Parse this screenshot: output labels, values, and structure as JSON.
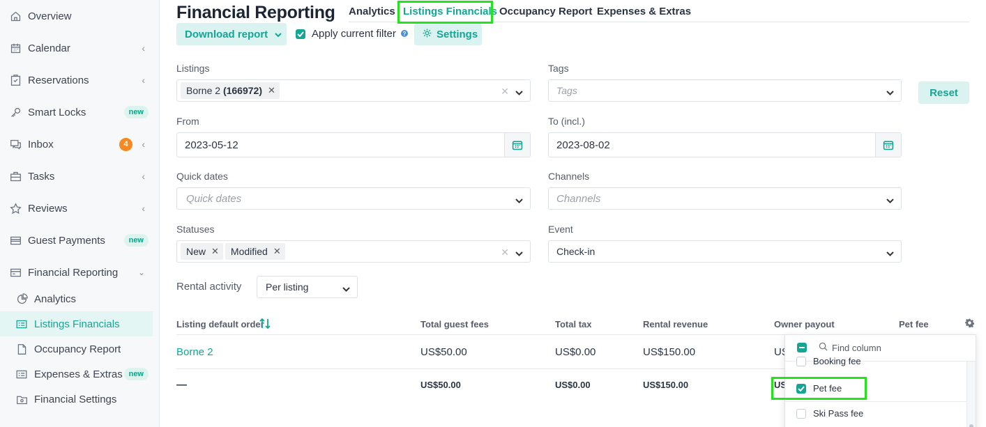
{
  "sidebar": {
    "items": [
      {
        "label": "Overview",
        "icon": "home-icon"
      },
      {
        "label": "Calendar",
        "icon": "calendar-icon"
      },
      {
        "label": "Reservations",
        "icon": "clipboard-check-icon"
      },
      {
        "label": "Smart Locks",
        "icon": "key-icon",
        "badge": "new"
      },
      {
        "label": "Inbox",
        "icon": "chat-icon",
        "count": "4"
      },
      {
        "label": "Tasks",
        "icon": "briefcase-icon"
      },
      {
        "label": "Reviews",
        "icon": "star-icon"
      },
      {
        "label": "Guest Payments",
        "icon": "credit-card-icon",
        "badge": "new"
      },
      {
        "label": "Financial Reporting",
        "icon": "credit-card-icon"
      }
    ],
    "sub_items": [
      {
        "label": "Analytics",
        "icon": "pie-chart-icon"
      },
      {
        "label": "Listings Financials",
        "icon": "list-card-icon"
      },
      {
        "label": "Occupancy Report",
        "icon": "document-icon"
      },
      {
        "label": "Expenses & Extras",
        "icon": "list-card-icon",
        "badge": "new"
      },
      {
        "label": "Financial Settings",
        "icon": "folder-gear-icon"
      }
    ]
  },
  "header": {
    "title": "Financial Reporting",
    "tabs": [
      "Analytics",
      "Listings Financials",
      "Occupancy Report",
      "Expenses & Extras"
    ],
    "active_tab": "Listings Financials"
  },
  "toolbar": {
    "download_label": "Download report",
    "apply_filter_label": "Apply current filter",
    "settings_label": "Settings"
  },
  "filters": {
    "listings_label": "Listings",
    "listings_chip_name": "Borne 2",
    "listings_chip_id": "(166972)",
    "tags_label": "Tags",
    "tags_placeholder": "Tags",
    "reset_label": "Reset",
    "from_label": "From",
    "from_value": "2023-05-12",
    "to_label": "To (incl.)",
    "to_value": "2023-08-02",
    "quick_dates_label": "Quick dates",
    "quick_dates_placeholder": "Quick dates",
    "channels_label": "Channels",
    "channels_placeholder": "Channels",
    "statuses_label": "Statuses",
    "status_chips": [
      "New",
      "Modified"
    ],
    "event_label": "Event",
    "event_value": "Check-in",
    "rental_activity_label": "Rental activity",
    "rental_activity_value": "Per listing"
  },
  "table": {
    "headers": [
      "Listing default order",
      "Total guest fees",
      "Total tax",
      "Rental revenue",
      "Owner payout",
      "Pet fee"
    ],
    "rows": [
      {
        "listing": "Borne 2",
        "guest_fees": "US$50.00",
        "tax": "US$0.00",
        "rental_revenue": "US$150.00",
        "owner_payout": "US"
      }
    ],
    "totals": {
      "listing": "—",
      "guest_fees": "US$50.00",
      "tax": "US$0.00",
      "rental_revenue": "US$150.00",
      "owner_payout": "US"
    }
  },
  "column_picker": {
    "search_placeholder": "Find column",
    "options": [
      {
        "label": "Booking fee",
        "checked": false
      },
      {
        "label": "Pet fee",
        "checked": true
      },
      {
        "label": "Ski Pass fee",
        "checked": false
      }
    ]
  },
  "colors": {
    "accent": "#15a595",
    "highlight": "#22e41b",
    "badge_orange": "#f6891f"
  }
}
